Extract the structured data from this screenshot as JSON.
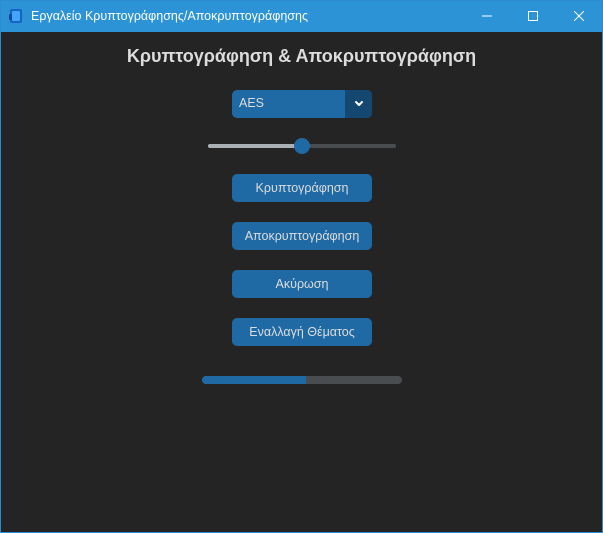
{
  "window": {
    "title": "Εργαλείο Κρυπτογράφησης/Αποκρυπτογράφησης"
  },
  "main": {
    "heading": "Κρυπτογράφηση & Αποκρυπτογράφηση",
    "algorithm_select": {
      "value": "AES"
    },
    "slider": {
      "value": 0.5
    },
    "buttons": {
      "encrypt": "Κρυπτογράφηση",
      "decrypt": "Αποκρυπτογράφηση",
      "cancel": "Ακύρωση",
      "toggle_theme": "Εναλλαγή Θέματος"
    },
    "progress": {
      "value": 0.52
    }
  },
  "colors": {
    "titlebar": "#2b93d6",
    "background": "#242424",
    "accent": "#1f6aa5",
    "accent_dark": "#144870",
    "text": "#dcdcdc"
  },
  "icons": {
    "app": "app-icon",
    "minimize": "minimize-icon",
    "maximize": "maximize-icon",
    "close": "close-icon",
    "dropdown": "chevron-down-icon"
  }
}
